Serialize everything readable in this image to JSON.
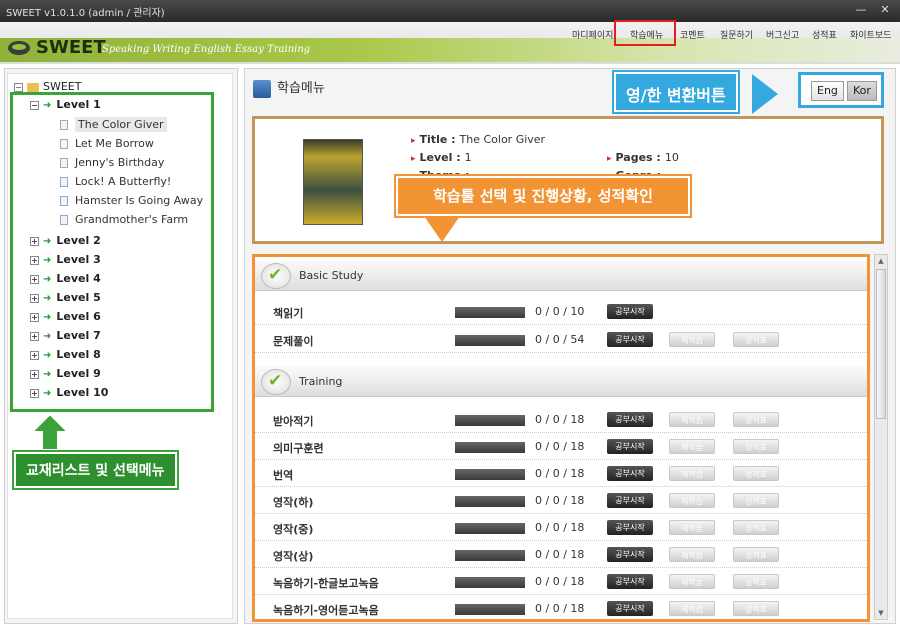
{
  "window": {
    "title": "SWEET v1.0.1.0 (admin / 관리자)",
    "minimize_glyph": "—",
    "close_glyph": "✕"
  },
  "brand": {
    "name": "SWEET",
    "tagline": "Speaking Writing English Essay Training"
  },
  "topnav": [
    {
      "label": "마디페이지"
    },
    {
      "label": "학습메뉴",
      "active": true
    },
    {
      "label": "코멘트"
    },
    {
      "label": "질문하기"
    },
    {
      "label": "버그신고"
    },
    {
      "label": "성적표"
    },
    {
      "label": "화이트보드"
    }
  ],
  "tree": {
    "root": "SWEET",
    "expanded_level": {
      "label": "Level 1",
      "books": [
        "The Color Giver",
        "Let Me Borrow",
        "Jenny's Birthday",
        "Lock! A Butterfly!",
        "Hamster Is Going Away",
        "Grandmother's Farm"
      ],
      "selected_book": "The Color Giver"
    },
    "collapsed_levels": [
      "Level 2",
      "Level 3",
      "Level 4",
      "Level 5",
      "Level 6",
      "Level 7",
      "Level 8",
      "Level 9",
      "Level 10"
    ]
  },
  "annotations": {
    "tree_label": "교재리스트 및 선택메뉴",
    "lang_label": "영/한 변환버튼",
    "study_label": "학습툴 선택 및 진행상황, 성적확인"
  },
  "main": {
    "heading": "학습메뉴",
    "lang_buttons": {
      "eng": "Eng",
      "kor": "Kor"
    },
    "book_info": {
      "title_key": "Title :",
      "title_value": "The Color Giver",
      "level_key": "Level :",
      "level_value": "1",
      "pages_key": "Pages :",
      "pages_value": "10",
      "theme_key": "Theme :",
      "genre_key": "Genre :"
    },
    "sections": [
      {
        "title": "Basic Study",
        "rows": [
          {
            "label": "책읽기",
            "progress": "0 / 0 / 10",
            "buttons": [
              "공부시작"
            ]
          },
          {
            "label": "문제풀이",
            "progress": "0 / 0 / 54",
            "buttons": [
              "공부시작",
              "재학습",
              "성적표"
            ]
          }
        ]
      },
      {
        "title": "Training",
        "rows": [
          {
            "label": "받아적기",
            "progress": "0 / 0 / 18",
            "buttons": [
              "공부시작",
              "재학습",
              "성적표"
            ]
          },
          {
            "label": "의미구훈련",
            "progress": "0 / 0 / 18",
            "buttons": [
              "공부시작",
              "재학습",
              "성적표"
            ]
          },
          {
            "label": "번역",
            "progress": "0 / 0 / 18",
            "buttons": [
              "공부시작",
              "재학습",
              "성적표"
            ]
          },
          {
            "label": "영작(하)",
            "progress": "0 / 0 / 18",
            "buttons": [
              "공부시작",
              "재학습",
              "성적표"
            ]
          },
          {
            "label": "영작(중)",
            "progress": "0 / 0 / 18",
            "buttons": [
              "공부시작",
              "재학습",
              "성적표"
            ]
          },
          {
            "label": "영작(상)",
            "progress": "0 / 0 / 18",
            "buttons": [
              "공부시작",
              "재학습",
              "성적표"
            ]
          },
          {
            "label": "녹음하기-한글보고녹음",
            "progress": "0 / 0 / 18",
            "buttons": [
              "공부시작",
              "재학습",
              "성적표"
            ]
          },
          {
            "label": "녹음하기-영어듣고녹음",
            "progress": "0 / 0 / 18",
            "buttons": [
              "공부시작",
              "재학습",
              "성적표"
            ]
          }
        ]
      }
    ]
  },
  "colors": {
    "tree_annotation": "#3aa33a",
    "lang_annotation": "#33a9e0",
    "study_annotation": "#f29433",
    "active_menu_outline": "#e02020"
  }
}
